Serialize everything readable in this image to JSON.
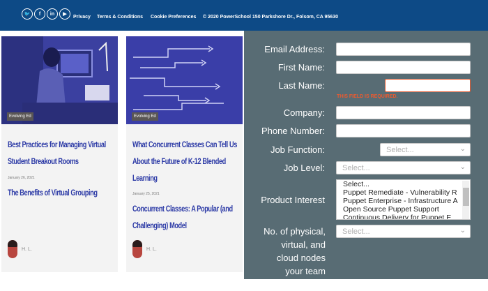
{
  "footer": {
    "social_icons": [
      "twitter-icon",
      "facebook-icon",
      "linkedin-icon",
      "youtube-icon"
    ],
    "social_glyphs": [
      "🐦",
      "f",
      "in",
      "▶"
    ],
    "links": [
      "Privacy",
      "Terms & Conditions",
      "Cookie Preferences"
    ],
    "copyright": "© 2020 PowerSchool 150 Parkshore Dr., Folsom, CA 95630"
  },
  "cards": [
    {
      "tag": "Evolving Ed",
      "title1": "Best Practices for Managing Virtual",
      "title2": "Student Breakout Rooms",
      "date": "January 26, 2021",
      "title3": "The Benefits of Virtual Grouping",
      "author": "H. L."
    },
    {
      "tag": "Evolving Ed",
      "title1": "What Concurrent Classes Can Tell Us",
      "title2": "About the Future of K-12 Blended",
      "title3": "Learning",
      "date": "January 25, 2021",
      "title4": "Concurrent Classes: A Popular (and",
      "title5": "Challenging) Model",
      "author": "H. L."
    }
  ],
  "form": {
    "email_label": "Email Address:",
    "first_name_label": "First Name:",
    "last_name_label": "Last Name:",
    "error": "THIS FIELD IS REQUIRED.",
    "company_label": "Company:",
    "phone_label": "Phone Number:",
    "job_function_label": "Job Function:",
    "job_function_value": "Select...",
    "job_level_label": "Job Level:",
    "job_level_value": "Select...",
    "product_interest_label": "Product Interest",
    "product_options": [
      "Select...",
      "Puppet Remediate - Vulnerability R",
      "Puppet Enterprise - Infrastructure A",
      "Open Source Puppet Support",
      "Continuous Delivery for Puppet E"
    ],
    "nodes_label": "No. of physical, virtual, and cloud nodes your team manages:",
    "nodes_value": "Select..."
  },
  "colors": {
    "header": "#0d4a86",
    "form_bg": "#586c74",
    "title": "#2c3aa6",
    "error": "#ee5a2e"
  }
}
